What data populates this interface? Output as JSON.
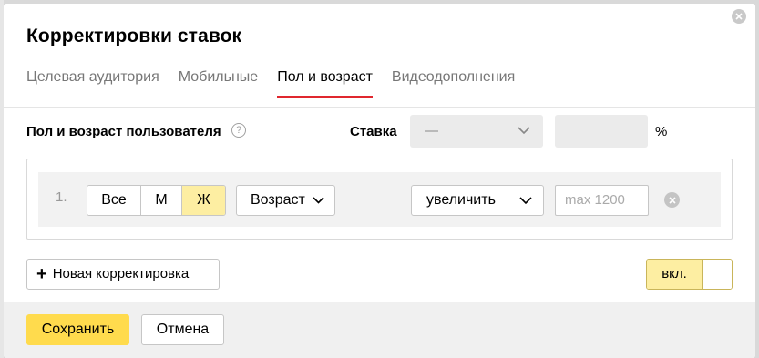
{
  "dialog": {
    "title": "Корректировки ставок",
    "close_icon": "close-icon"
  },
  "tabs": [
    {
      "label": "Целевая аудитория",
      "active": false
    },
    {
      "label": "Мобильные",
      "active": false
    },
    {
      "label": "Пол и возраст",
      "active": true
    },
    {
      "label": "Видеодополнения",
      "active": false
    }
  ],
  "section": {
    "label": "Пол и возраст пользователя",
    "help_symbol": "?",
    "rate_label": "Ставка",
    "rate_select_value": "—",
    "rate_input_value": "",
    "percent_sign": "%"
  },
  "rule": {
    "index": "1.",
    "gender_options": [
      {
        "label": "Все",
        "active": false
      },
      {
        "label": "М",
        "active": false
      },
      {
        "label": "Ж",
        "active": true
      }
    ],
    "age_select": "Возраст",
    "action_select": "увеличить",
    "value_placeholder": "max 1200"
  },
  "add_button_label": "Новая корректировка",
  "toggle_label": "вкл.",
  "footer": {
    "save_label": "Сохранить",
    "cancel_label": "Отмена"
  },
  "colors": {
    "accent_yellow": "#ffdb4d",
    "active_tab_underline": "#e0272e",
    "selected_segment": "#fdeea2"
  }
}
